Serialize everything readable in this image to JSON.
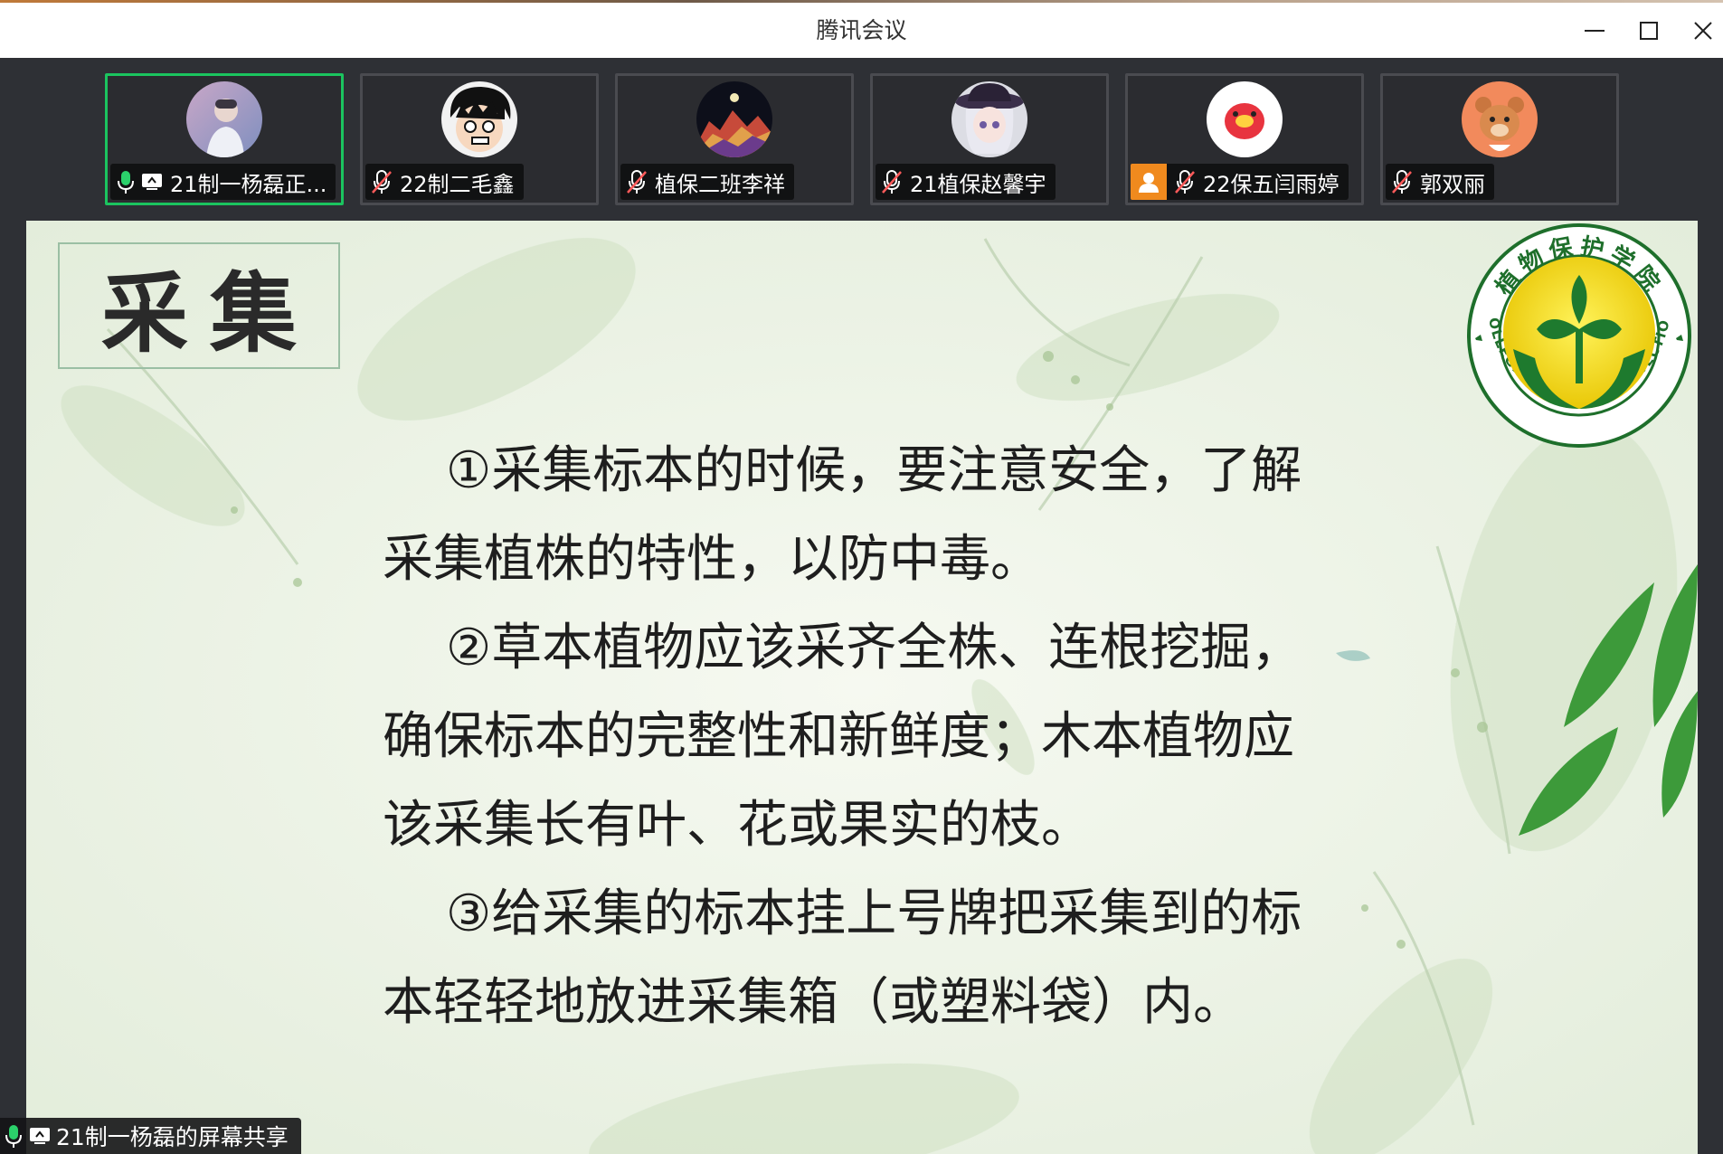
{
  "window": {
    "title": "腾讯会议",
    "controls": [
      "minimize",
      "maximize",
      "close"
    ]
  },
  "participants": [
    {
      "name": "21制一杨磊正...",
      "mic": "on",
      "sharing": true,
      "active": true,
      "avatar": "person-photo"
    },
    {
      "name": "22制二毛鑫",
      "mic": "muted",
      "sharing": false,
      "active": false,
      "avatar": "anime-boy"
    },
    {
      "name": "植保二班李祥",
      "mic": "muted",
      "sharing": false,
      "active": false,
      "avatar": "mountain-night"
    },
    {
      "name": "21植保赵馨宇",
      "mic": "muted",
      "sharing": false,
      "active": false,
      "avatar": "anime-girl-hat"
    },
    {
      "name": "22保五闫雨婷",
      "mic": "muted",
      "sharing": false,
      "active": false,
      "host": true,
      "avatar": "red-mascot"
    },
    {
      "name": "郭双丽",
      "mic": "muted",
      "sharing": false,
      "active": false,
      "avatar": "cartoon-bear"
    }
  ],
  "slide": {
    "title": "采集",
    "paragraphs": [
      "①采集标本的时候，要注意安全，了解采集植株的特性，以防中毒。",
      "②草本植物应该采齐全株、连根挖掘，确保标本的完整性和新鲜度；木本植物应该采集长有叶、花或果实的枝。",
      "③给采集的标本挂上号牌把采集到的标本轻轻地放进采集箱（或塑料袋）内。"
    ],
    "logo": {
      "top_text": "植物保护学院",
      "bottom_text": "COLLEGE OF PLANT PROTECTION"
    }
  },
  "share_label": "21制一杨磊的屏幕共享",
  "colors": {
    "active_border": "#1bc45f",
    "mic_on": "#2bd16b",
    "mic_muted": "#ff5a5a",
    "host_badge": "#f08a1e",
    "logo_green": "#1e7a2e",
    "logo_yellow": "#f5d90a"
  }
}
